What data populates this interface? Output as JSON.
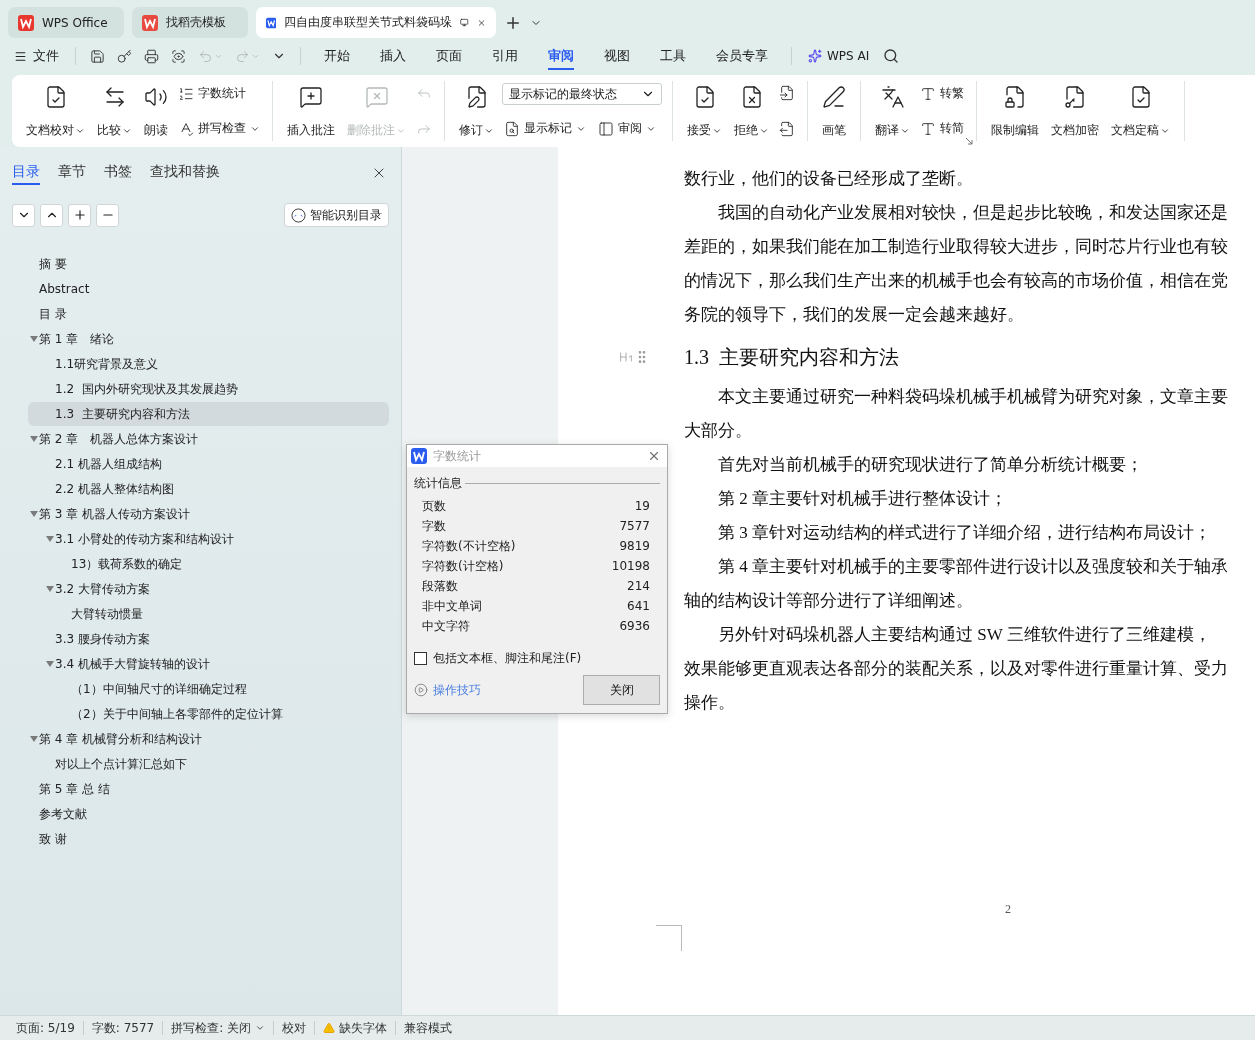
{
  "tabs": [
    {
      "label": "WPS Office",
      "kind": "home",
      "selected": false
    },
    {
      "label": "找稻壳模板",
      "kind": "template",
      "selected": false
    },
    {
      "label": "四自由度串联型关节式料袋码垛",
      "kind": "document",
      "selected": true
    }
  ],
  "quick_access": [
    {
      "disabled": false
    },
    {
      "disabled": false
    },
    {
      "disabled": false
    },
    {
      "disabled": false
    },
    {
      "disabled": true
    },
    {
      "disabled": true
    }
  ],
  "file_menu": "文件",
  "menu_tabs": [
    {
      "label": "开始",
      "selected": false
    },
    {
      "label": "插入",
      "selected": false
    },
    {
      "label": "页面",
      "selected": false
    },
    {
      "label": "引用",
      "selected": false
    },
    {
      "label": "审阅",
      "selected": true
    },
    {
      "label": "视图",
      "selected": false
    },
    {
      "label": "工具",
      "selected": false
    },
    {
      "label": "会员专享",
      "selected": false
    }
  ],
  "ai_button": "WPS AI",
  "ribbon": [
    {
      "items": [
        {
          "kind": "large",
          "label": "文档校对",
          "dropdown": true,
          "disabled": false
        },
        {
          "kind": "large",
          "label": "比较",
          "dropdown": true,
          "disabled": false
        },
        {
          "kind": "large",
          "label": "朗读",
          "dropdown": false,
          "disabled": false
        },
        {
          "kind": "stack",
          "rows": [
            [
              {
                "kind": "small",
                "label": "字数统计",
                "dropdown": false,
                "disabled": false
              }
            ],
            [
              {
                "kind": "small",
                "label": "拼写检查",
                "dropdown": true,
                "disabled": false
              }
            ]
          ]
        }
      ]
    },
    {
      "items": [
        {
          "kind": "large",
          "label": "插入批注",
          "dropdown": false,
          "disabled": false
        },
        {
          "kind": "large",
          "label": "删除批注",
          "dropdown": true,
          "disabled": true
        },
        {
          "kind": "stack",
          "rows": [
            [
              {
                "kind": "icon",
                "dropdown": false,
                "disabled": true
              }
            ],
            [
              {
                "kind": "icon",
                "dropdown": false,
                "disabled": true
              }
            ]
          ]
        }
      ]
    },
    {
      "items": [
        {
          "kind": "large",
          "label": "修订",
          "dropdown": true,
          "disabled": false
        },
        {
          "kind": "stack",
          "rows": [
            [
              {
                "kind": "select",
                "value": "显示标记的最终状态",
                "dropdown": true,
                "disabled": false
              }
            ],
            [
              {
                "kind": "small",
                "label": "显示标记",
                "dropdown": true,
                "disabled": false
              },
              {
                "kind": "small",
                "label": "审阅",
                "dropdown": true,
                "disabled": false
              }
            ]
          ]
        }
      ]
    },
    {
      "items": [
        {
          "kind": "large",
          "label": "接受",
          "dropdown": true,
          "disabled": false
        },
        {
          "kind": "large",
          "label": "拒绝",
          "dropdown": true,
          "disabled": false
        },
        {
          "kind": "stack",
          "rows": [
            [
              {
                "kind": "icon",
                "dropdown": false,
                "disabled": false
              }
            ],
            [
              {
                "kind": "icon",
                "dropdown": false,
                "disabled": false
              }
            ]
          ]
        }
      ]
    },
    {
      "items": [
        {
          "kind": "large",
          "label": "画笔",
          "dropdown": false,
          "disabled": false
        }
      ]
    },
    {
      "items": [
        {
          "kind": "large",
          "label": "翻译",
          "dropdown": true,
          "disabled": false
        },
        {
          "kind": "stack",
          "rows": [
            [
              {
                "kind": "small",
                "label": "转繁",
                "dropdown": false,
                "disabled": false
              }
            ],
            [
              {
                "kind": "small",
                "label": "转简",
                "dropdown": false,
                "disabled": false
              }
            ]
          ]
        }
      ]
    },
    {
      "items": [
        {
          "kind": "large",
          "label": "限制编辑",
          "dropdown": false,
          "disabled": false
        },
        {
          "kind": "large",
          "label": "文档加密",
          "dropdown": false,
          "disabled": false
        },
        {
          "kind": "large",
          "label": "文档定稿",
          "dropdown": true,
          "disabled": false
        }
      ]
    }
  ],
  "nav_pane": {
    "tabs": [
      {
        "label": "目录",
        "selected": true
      },
      {
        "label": "章节",
        "selected": false
      },
      {
        "label": "书签",
        "selected": false
      },
      {
        "label": "查找和替换",
        "selected": false
      }
    ],
    "smart_button": "智能识别目录",
    "items": [
      {
        "label": "摘 要",
        "selected": false
      },
      {
        "label": "Abstract",
        "selected": false
      },
      {
        "label": "目 录",
        "selected": false
      },
      {
        "label": "第 1 章　绪论",
        "selected": false,
        "expanded": true,
        "children": [
          {
            "label": "1.1研究背景及意义",
            "selected": false
          },
          {
            "label": "1.2  国内外研究现状及其发展趋势",
            "selected": false
          },
          {
            "label": "1.3  主要研究内容和方法",
            "selected": true
          }
        ]
      },
      {
        "label": "第 2 章　机器人总体方案设计",
        "selected": false,
        "expanded": true,
        "children": [
          {
            "label": "2.1 机器人组成结构",
            "selected": false
          },
          {
            "label": "2.2 机器人整体结构图",
            "selected": false
          }
        ]
      },
      {
        "label": "第 3 章 机器人传动方案设计",
        "selected": false,
        "expanded": true,
        "children": [
          {
            "label": "3.1 小臂处的传动方案和结构设计",
            "selected": false,
            "expanded": true,
            "children": [
              {
                "label": "13）载荷系数的确定",
                "selected": false
              }
            ]
          },
          {
            "label": "3.2 大臂传动方案",
            "selected": false,
            "expanded": true,
            "children": [
              {
                "label": "大臂转动惯量",
                "selected": false
              }
            ]
          },
          {
            "label": "3.3 腰身传动方案",
            "selected": false
          },
          {
            "label": "3.4 机械手大臂旋转轴的设计",
            "selected": false,
            "expanded": true,
            "children": [
              {
                "label": "（1）中间轴尺寸的详细确定过程",
                "selected": false
              },
              {
                "label": "（2）关于中间轴上各零部件的定位计算",
                "selected": false
              }
            ]
          }
        ]
      },
      {
        "label": "第 4 章 机械臂分析和结构设计",
        "selected": false,
        "expanded": true,
        "children": [
          {
            "label": "对以上个点计算汇总如下",
            "selected": false
          }
        ]
      },
      {
        "label": "第 5 章 总 结",
        "selected": false
      },
      {
        "label": "参考文献",
        "selected": false
      },
      {
        "label": "致 谢",
        "selected": false
      }
    ]
  },
  "document": {
    "lines": [
      {
        "kind": "text",
        "text": "数行业，他们的设备已经形成了垄断。"
      },
      {
        "kind": "first_line",
        "text": "我国的自动化产业发展相对较快，但是起步比较晚，和发达国家还是"
      },
      {
        "kind": "text",
        "text": "差距的，如果我们能在加工制造行业取得较大进步，同时芯片行业也有较"
      },
      {
        "kind": "text",
        "text": "的情况下，那么我们生产出来的机械手也会有较高的市场价值，相信在党"
      },
      {
        "kind": "text",
        "text": "务院的领导下，我们的发展一定会越来越好。"
      },
      {
        "kind": "heading",
        "text": "1.3  主要研究内容和方法"
      },
      {
        "kind": "first_line",
        "text": "本文主要通过研究一种料袋码垛机械手机械臂为研究对象，文章主要"
      },
      {
        "kind": "text",
        "text": "大部分。"
      },
      {
        "kind": "first_line",
        "text": "首先对当前机械手的研究现状进行了简单分析统计概要；"
      },
      {
        "kind": "first_line",
        "text": "第 2 章主要针对机械手进行整体设计；"
      },
      {
        "kind": "first_line",
        "text": "第 3 章针对运动结构的样式进行了详细介绍，进行结构布局设计；"
      },
      {
        "kind": "first_line",
        "text": "第 4 章主要针对机械手的主要零部件进行设计以及强度较和关于轴承"
      },
      {
        "kind": "text",
        "text": "轴的结构设计等部分进行了详细阐述。"
      },
      {
        "kind": "first_line",
        "text": "另外针对码垛机器人主要结构通过 SW 三维软件进行了三维建模，"
      },
      {
        "kind": "text",
        "text": "效果能够更直观表达各部分的装配关系，以及对零件进行重量计算、受力"
      },
      {
        "kind": "text",
        "text": "操作。"
      }
    ],
    "page_number": "2"
  },
  "dialog": {
    "title": "字数统计",
    "section": "统计信息",
    "rows": [
      {
        "label": "页数",
        "value": "19"
      },
      {
        "label": "字数",
        "value": "7577"
      },
      {
        "label": "字符数(不计空格)",
        "value": "9819"
      },
      {
        "label": "字符数(计空格)",
        "value": "10198"
      },
      {
        "label": "段落数",
        "value": "214"
      },
      {
        "label": "非中文单词",
        "value": "641"
      },
      {
        "label": "中文字符",
        "value": "6936"
      }
    ],
    "checkbox": {
      "label": "包括文本框、脚注和尾注(F)",
      "checked": false
    },
    "link": "操作技巧",
    "button": "关闭"
  },
  "status_bar": [
    {
      "kind": "text",
      "label": "页面: 5/19"
    },
    {
      "kind": "text",
      "label": "字数: 7577"
    },
    {
      "kind": "dropdown",
      "label": "拼写检查: 关闭"
    },
    {
      "kind": "text",
      "label": "校对"
    },
    {
      "kind": "warning",
      "label": "缺失字体"
    },
    {
      "kind": "text",
      "label": "兼容模式"
    }
  ]
}
